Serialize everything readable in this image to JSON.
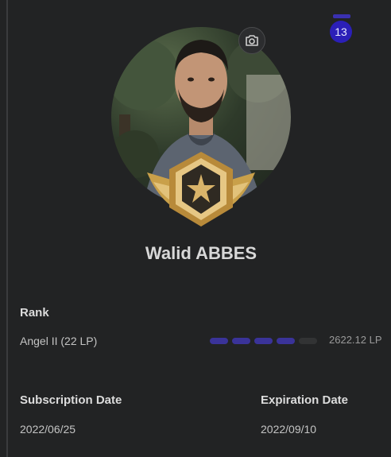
{
  "notification": {
    "count": "13"
  },
  "profile": {
    "name": "Walid ABBES",
    "avatar_icon": "user-photo",
    "rank_badge_icon": "gold-star-wing-badge",
    "camera_icon": "camera-icon"
  },
  "rank": {
    "label": "Rank",
    "value": "Angel II (22 LP)",
    "progress_segments_filled": 4,
    "progress_segments_total": 5,
    "points": "2622.12 LP"
  },
  "subscription": {
    "label": "Subscription Date",
    "value": "2022/06/25"
  },
  "expiration": {
    "label": "Expiration Date",
    "value": "2022/09/10"
  },
  "colors": {
    "background": "#222324",
    "accent": "#3a3399",
    "badge": "#2b1fb8",
    "gold": "#c9a04a"
  }
}
